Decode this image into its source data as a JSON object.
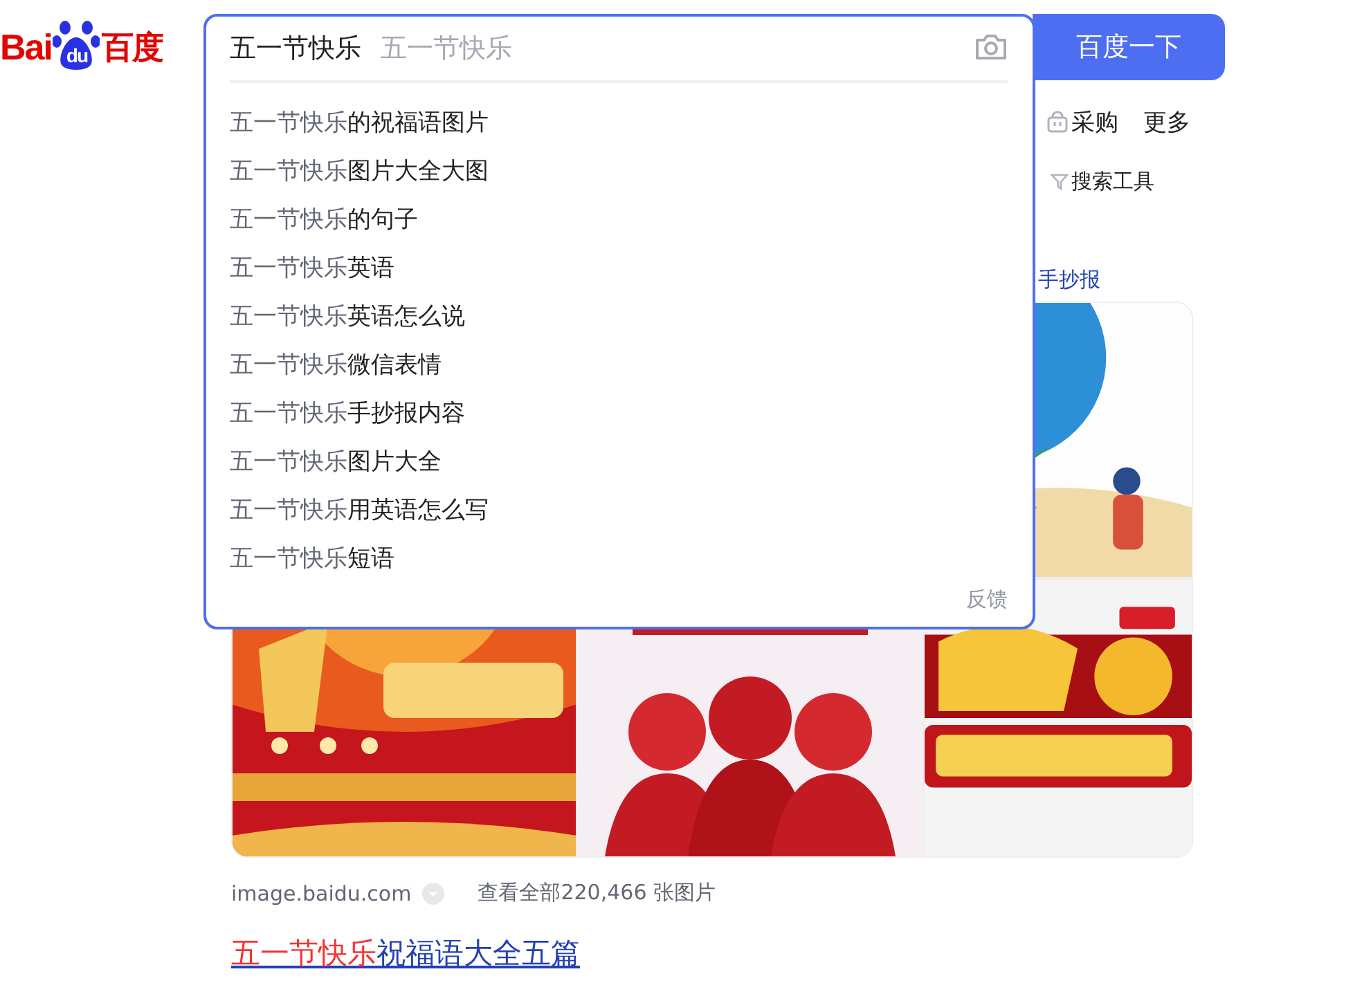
{
  "logo": {
    "text_left": "Bai",
    "text_mid": "du",
    "text_right": "百度"
  },
  "search": {
    "value": "五一节快乐",
    "hint": "五一节快乐",
    "button": "百度一下"
  },
  "suggestions": [
    {
      "prefix": "五一节快乐",
      "rest": "的祝福语图片"
    },
    {
      "prefix": "五一节快乐",
      "rest": "图片大全大图"
    },
    {
      "prefix": "五一节快乐",
      "rest": "的句子"
    },
    {
      "prefix": "五一节快乐",
      "rest": "英语"
    },
    {
      "prefix": "五一节快乐",
      "rest": "英语怎么说"
    },
    {
      "prefix": "五一节快乐",
      "rest": "微信表情"
    },
    {
      "prefix": "五一节快乐",
      "rest": "手抄报内容"
    },
    {
      "prefix": "五一节快乐",
      "rest": "图片大全"
    },
    {
      "prefix": "五一节快乐",
      "rest": "用英语怎么写"
    },
    {
      "prefix": "五一节快乐",
      "rest": "短语"
    }
  ],
  "feedback": "反馈",
  "nav_tabs": [
    {
      "kind": "shop",
      "label": "采购"
    },
    {
      "kind": "plain",
      "label": "更多"
    }
  ],
  "search_tools": "搜索工具",
  "related_link": "手抄报",
  "image_result": {
    "source": "image.baidu.com",
    "view_all": "查看全部220,466 张图片"
  },
  "result_title": {
    "highlight": "五一节快乐",
    "rest": "祝福语大全五篇"
  }
}
